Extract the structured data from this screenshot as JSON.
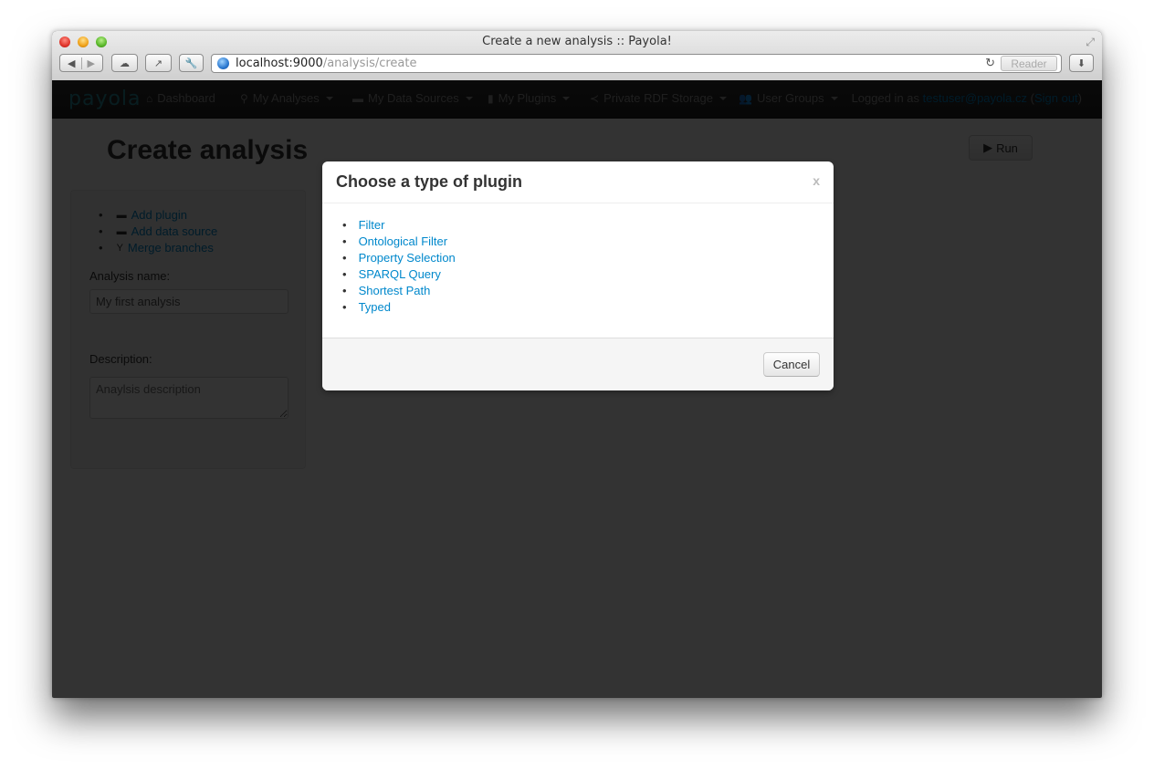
{
  "browser": {
    "window_title": "Create a new analysis :: Payola!",
    "url_host": "localhost:9000",
    "url_path": "/analysis/create",
    "reader_label": "Reader"
  },
  "navbar": {
    "logo": "payola",
    "items": [
      {
        "label": "Dashboard",
        "icon": "home-icon",
        "dropdown": false
      },
      {
        "label": "My Analyses",
        "icon": "search-icon",
        "dropdown": true
      },
      {
        "label": "My Data Sources",
        "icon": "hdd-icon",
        "dropdown": true
      },
      {
        "label": "My Plugins",
        "icon": "file-icon",
        "dropdown": true
      },
      {
        "label": "Private RDF Storage",
        "icon": "share-icon",
        "dropdown": true
      },
      {
        "label": "User Groups",
        "icon": "users-icon",
        "dropdown": true
      }
    ],
    "login_prefix": "Logged in as",
    "user_email": "testuser@payola.cz",
    "sign_out": "Sign out"
  },
  "page": {
    "title": "Create analysis",
    "run_label": "Run",
    "actions": [
      {
        "label": "Add plugin",
        "icon": "hdd-icon"
      },
      {
        "label": "Add data source",
        "icon": "hdd-icon"
      },
      {
        "label": "Merge branches",
        "icon": "glass-icon"
      }
    ],
    "name_label": "Analysis name:",
    "name_value": "My first analysis",
    "description_label": "Description:",
    "description_placeholder": "Anaylsis description"
  },
  "modal": {
    "title": "Choose a type of plugin",
    "close": "x",
    "plugins": [
      "Filter",
      "Ontological Filter",
      "Property Selection",
      "SPARQL Query",
      "Shortest Path",
      "Typed"
    ],
    "cancel_label": "Cancel"
  }
}
